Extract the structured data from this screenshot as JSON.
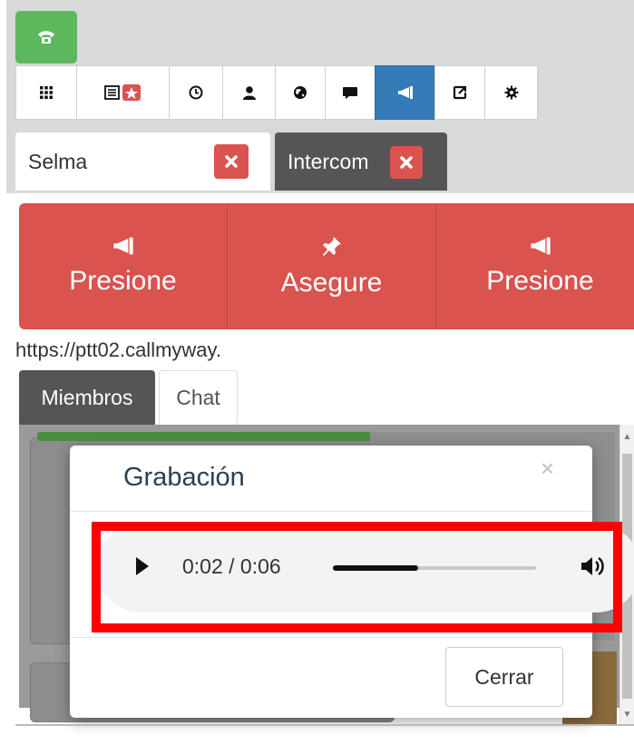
{
  "toolbar": {
    "phone_icon": "phone-icon",
    "buttons": [
      {
        "icon": "grid-icon"
      },
      {
        "icon": "list-star-icon"
      },
      {
        "icon": "clock-icon"
      },
      {
        "icon": "user-icon"
      },
      {
        "icon": "globe-icon"
      },
      {
        "icon": "chat-bubble-icon"
      },
      {
        "icon": "megaphone-icon",
        "active": true
      },
      {
        "icon": "share-icon"
      },
      {
        "icon": "gear-icon"
      }
    ]
  },
  "tabs": [
    {
      "label": "Selma",
      "active": true
    },
    {
      "label": "Intercom",
      "active": false
    }
  ],
  "actions": [
    {
      "label": "Presione",
      "icon": "megaphone-icon"
    },
    {
      "label": "Asegure",
      "icon": "pin-icon"
    },
    {
      "label": "Presione",
      "icon": "megaphone-icon"
    }
  ],
  "url": "https://ptt02.callmyway.",
  "sub_tabs": [
    {
      "label": "Miembros",
      "active": true
    },
    {
      "label": "Chat",
      "active": false
    }
  ],
  "modal": {
    "title": "Grabación",
    "close_symbol": "×",
    "audio": {
      "time": "0:02 / 0:06",
      "progress": 0.42
    },
    "close_button": "Cerrar"
  },
  "colors": {
    "phone_green": "#5cb85c",
    "active_blue": "#337ab7",
    "action_red": "#d9534f",
    "tab_dark": "#555555",
    "highlight": "#ff0000"
  }
}
